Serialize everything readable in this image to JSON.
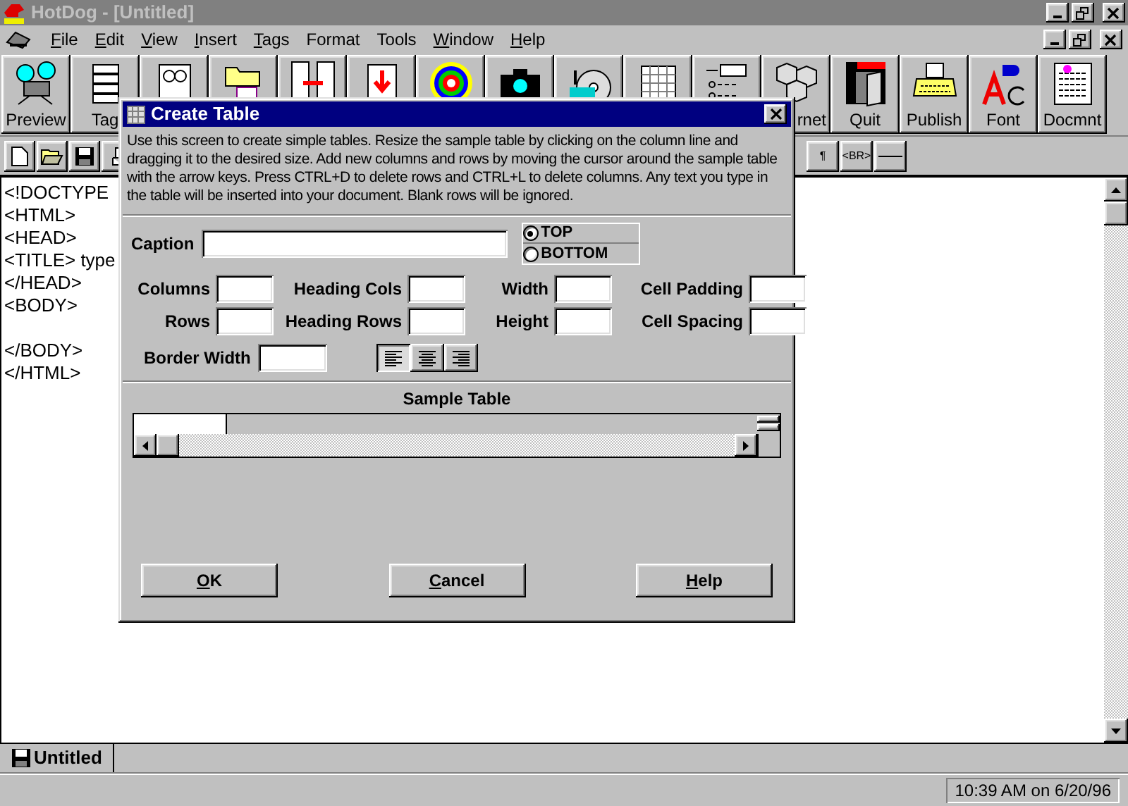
{
  "window": {
    "title": "HotDog - [Untitled]"
  },
  "menu": [
    {
      "label": "File",
      "underline_first": true
    },
    {
      "label": "Edit",
      "underline_first": true
    },
    {
      "label": "View",
      "underline_first": true
    },
    {
      "label": "Insert",
      "underline_first": true
    },
    {
      "label": "Tags",
      "underline_first": true
    },
    {
      "label": "Format",
      "underline_first": false
    },
    {
      "label": "Tools",
      "underline_first": false
    },
    {
      "label": "Window",
      "underline_first": true
    },
    {
      "label": "Help",
      "underline_first": true
    }
  ],
  "big_toolbar": [
    {
      "kind": "projector",
      "label": "Preview"
    },
    {
      "kind": "tags",
      "label": "Tag"
    },
    {
      "kind": "clipart"
    },
    {
      "kind": "folder"
    },
    {
      "kind": "docs"
    },
    {
      "kind": "download"
    },
    {
      "kind": "target"
    },
    {
      "kind": "camera"
    },
    {
      "kind": "cd"
    },
    {
      "kind": "grid"
    },
    {
      "kind": "form"
    },
    {
      "kind": "cubes",
      "label": "rnet",
      "label_clipped": true
    },
    {
      "kind": "exit",
      "label": "Quit"
    },
    {
      "kind": "typewriter",
      "label": "Publish"
    },
    {
      "kind": "font",
      "label": "Font"
    },
    {
      "kind": "document",
      "label": "Docmnt"
    }
  ],
  "small_toolbar_left": [
    {
      "kind": "new"
    },
    {
      "kind": "open"
    },
    {
      "kind": "save"
    },
    {
      "kind": "print"
    }
  ],
  "small_toolbar_right": [
    {
      "kind": "text",
      "label": "¶"
    },
    {
      "kind": "text",
      "label": "<BR>"
    },
    {
      "kind": "rule"
    }
  ],
  "editor": {
    "lines": [
      {
        "kind": "text",
        "text": "<!DOCTYPE"
      },
      {
        "kind": "text",
        "text": "<HTML>"
      },
      {
        "kind": "text",
        "text": "<HEAD>"
      },
      {
        "kind": "text",
        "text": "<TITLE> type"
      },
      {
        "kind": "text",
        "text": "</HEAD>"
      },
      {
        "kind": "text",
        "text": "<BODY>"
      },
      {
        "kind": "blank"
      },
      {
        "kind": "text",
        "text": "</BODY>"
      },
      {
        "kind": "text",
        "text": "</HTML>"
      }
    ]
  },
  "doc_tabs": [
    {
      "label": "Untitled",
      "selected": true
    }
  ],
  "status_bar": {
    "time": "10:39 AM on 6/20/96"
  },
  "dialog": {
    "title": "Create Table",
    "description": "Use this screen to create simple tables. Resize the sample table by clicking on the column line and dragging it to the desired size. Add new columns and rows by moving the cursor around the sample table with the arrow keys. Press CTRL+D to delete rows and CTRL+L to delete columns. Any text you type in the table will be inserted into your document. Blank rows will be ignored.",
    "caption": {
      "label": "Caption"
    },
    "caption_position": [
      {
        "label": "TOP",
        "selected": true
      },
      {
        "label": "BOTTOM",
        "selected": false
      }
    ],
    "fields": [
      {
        "label": "Columns"
      },
      {
        "label": "Heading Cols"
      },
      {
        "label": "Width"
      },
      {
        "label": "Cell Padding"
      },
      {
        "label": "Rows"
      },
      {
        "label": "Heading Rows"
      },
      {
        "label": "Height"
      },
      {
        "label": "Cell Spacing"
      }
    ],
    "border_width": {
      "label": "Border Width"
    },
    "alignment": [
      {
        "kind": "left",
        "selected": true
      },
      {
        "kind": "center",
        "selected": false
      },
      {
        "kind": "right",
        "selected": false
      }
    ],
    "sample_table": {
      "label": "Sample Table"
    },
    "buttons": [
      {
        "label": "OK",
        "underline_first": true
      },
      {
        "label": "Cancel",
        "underline_first": true
      },
      {
        "label": "Help",
        "underline_first": true
      }
    ]
  }
}
